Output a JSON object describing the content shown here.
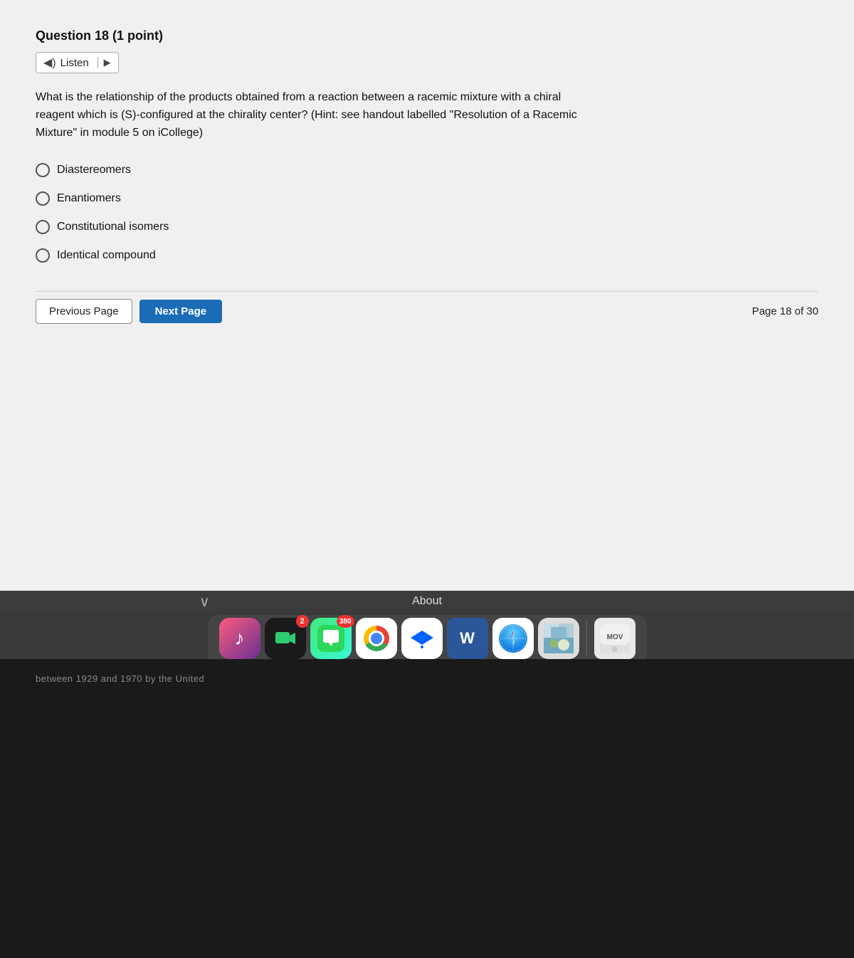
{
  "question": {
    "number": "18",
    "points": "(1 point)",
    "header": "Question 18 (1 point)",
    "listen_label": "Listen",
    "text": "What is the relationship of the products obtained from a reaction between a racemic mixture with a chiral reagent which is (S)-configured at the chirality center? (Hint: see handout labelled \"Resolution of a Racemic Mixture\" in module 5 on iCollege)",
    "options": [
      {
        "id": "opt1",
        "label": "Diastereomers"
      },
      {
        "id": "opt2",
        "label": "Enantiomers"
      },
      {
        "id": "opt3",
        "label": "Constitutional isomers"
      },
      {
        "id": "opt4",
        "label": "Identical compound"
      }
    ]
  },
  "navigation": {
    "prev_label": "Previous Page",
    "next_label": "Next Page",
    "page_info": "Page 18 of 30"
  },
  "dock": {
    "about_label": "About",
    "icons": [
      {
        "id": "music",
        "label": "Music",
        "badge": null,
        "icon_char": "♪"
      },
      {
        "id": "facetime",
        "label": "FaceTime",
        "badge": "2",
        "icon_char": "📹"
      },
      {
        "id": "messages",
        "label": "Messages",
        "badge": "380",
        "icon_char": "💬"
      },
      {
        "id": "chrome",
        "label": "Chrome",
        "badge": null,
        "icon_char": ""
      },
      {
        "id": "dropbox",
        "label": "Dropbox",
        "badge": null,
        "icon_char": "✦"
      },
      {
        "id": "word",
        "label": "Word",
        "badge": null,
        "icon_char": "W"
      },
      {
        "id": "safari",
        "label": "Safari",
        "badge": null,
        "icon_char": ""
      },
      {
        "id": "photos",
        "label": "Photos",
        "badge": null,
        "icon_char": "🖼"
      },
      {
        "id": "mov",
        "label": "QuickTime",
        "badge": null,
        "icon_char": "MOV"
      }
    ]
  },
  "bottom_text": "between 1929 and 1970 by the United"
}
